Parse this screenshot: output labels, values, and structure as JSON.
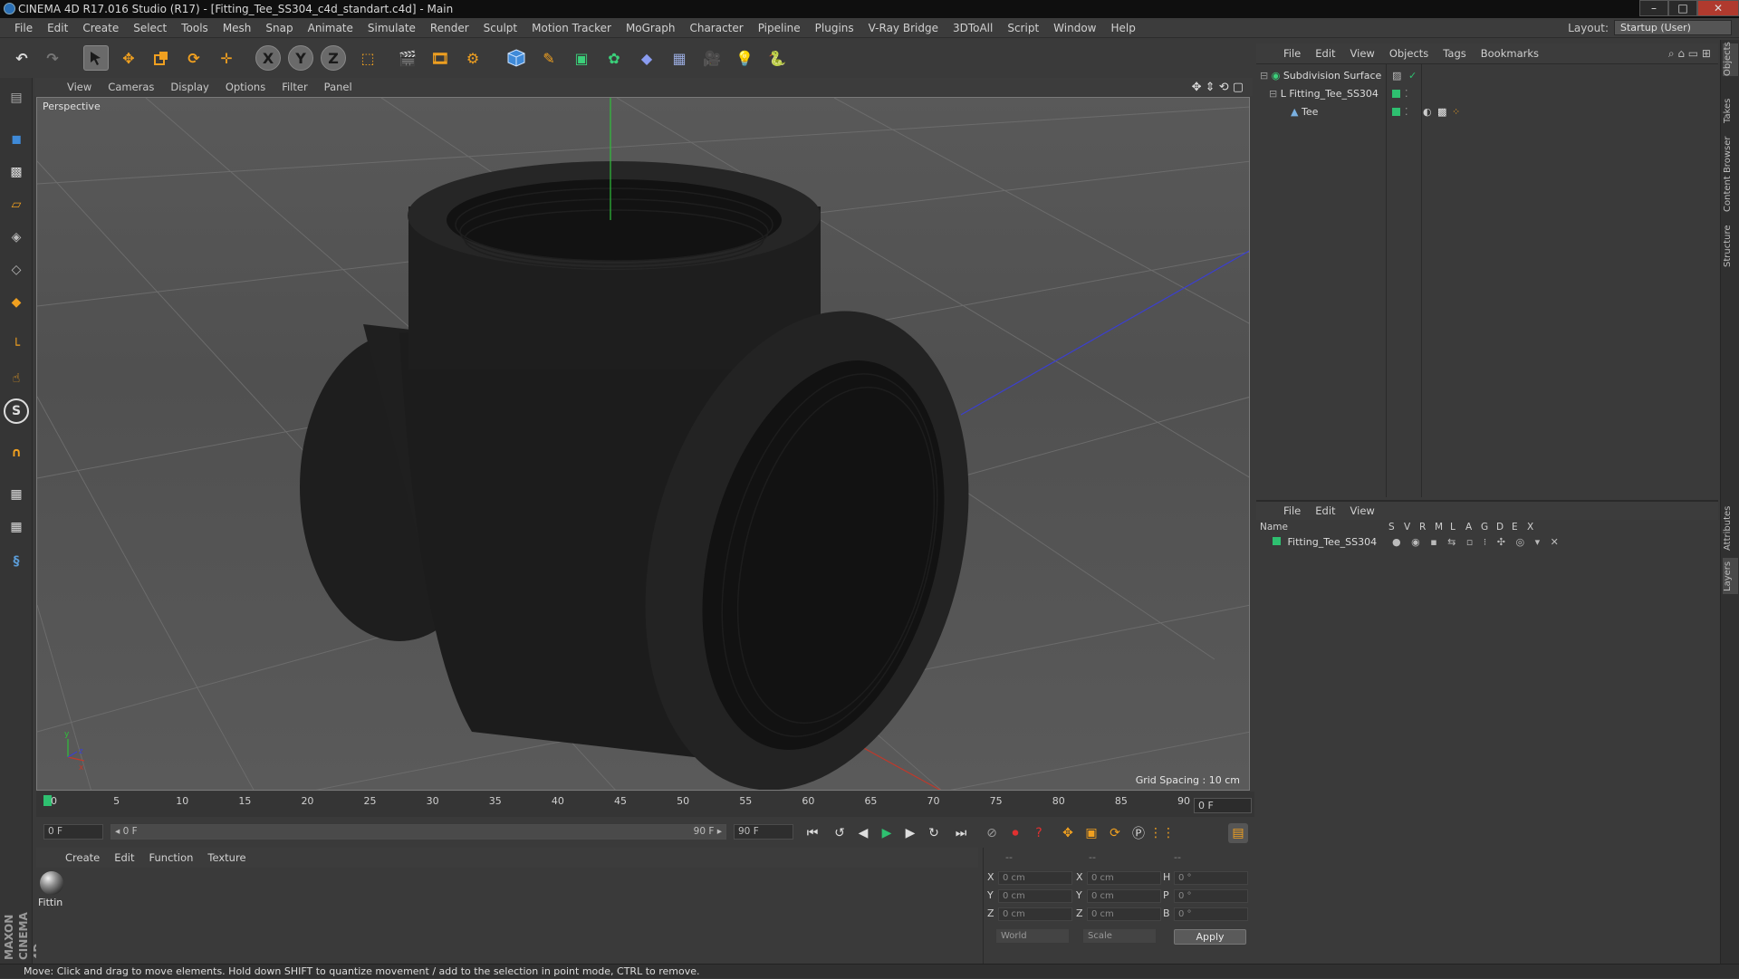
{
  "window": {
    "title": "CINEMA 4D R17.016 Studio (R17) - [Fitting_Tee_SS304_c4d_standart.c4d] - Main",
    "min": "–",
    "max": "□",
    "close": "✕"
  },
  "menu": [
    "File",
    "Edit",
    "Create",
    "Select",
    "Tools",
    "Mesh",
    "Snap",
    "Animate",
    "Simulate",
    "Render",
    "Sculpt",
    "Motion Tracker",
    "MoGraph",
    "Character",
    "Pipeline",
    "Plugins",
    "V-Ray Bridge",
    "3DToAll",
    "Script",
    "Window",
    "Help"
  ],
  "layout": {
    "label": "Layout:",
    "value": "Startup (User)"
  },
  "toolbar": {
    "x_axis": "X",
    "y_axis": "Y",
    "z_axis": "Z"
  },
  "viewport": {
    "menu": [
      "View",
      "Cameras",
      "Display",
      "Options",
      "Filter",
      "Panel"
    ],
    "label": "Perspective",
    "grid_spacing": "Grid Spacing : 10 cm",
    "axis_x": "x",
    "axis_y": "y",
    "axis_z": "z"
  },
  "timeline": {
    "ticks": [
      "0",
      "5",
      "10",
      "15",
      "20",
      "25",
      "30",
      "35",
      "40",
      "45",
      "50",
      "55",
      "60",
      "65",
      "70",
      "75",
      "80",
      "85",
      "90"
    ],
    "current_frame": "0 F",
    "start_field": "0 F",
    "range_start": "◂ 0 F",
    "range_end": "90 F ▸",
    "end_field": "90 F"
  },
  "materials": {
    "menu": [
      "Create",
      "Edit",
      "Function",
      "Texture"
    ],
    "items": [
      {
        "name": "Fittin"
      }
    ]
  },
  "coords": {
    "headers": [
      "--",
      "--",
      "--"
    ],
    "rows": [
      {
        "a": "X",
        "av": "0 cm",
        "b": "X",
        "bv": "0 cm",
        "c": "H",
        "cv": "0 °"
      },
      {
        "a": "Y",
        "av": "0 cm",
        "b": "Y",
        "bv": "0 cm",
        "c": "P",
        "cv": "0 °"
      },
      {
        "a": "Z",
        "av": "0 cm",
        "b": "Z",
        "bv": "0 cm",
        "c": "B",
        "cv": "0 °"
      }
    ],
    "mode_world": "World",
    "mode_scale": "Scale",
    "apply": "Apply"
  },
  "objects": {
    "menu": [
      "File",
      "Edit",
      "View",
      "Objects",
      "Tags",
      "Bookmarks"
    ],
    "tree": [
      {
        "name": "Subdivision Surface",
        "indent": 0
      },
      {
        "name": "Fitting_Tee_SS304",
        "indent": 1
      },
      {
        "name": "Tee",
        "indent": 2
      }
    ]
  },
  "layers": {
    "menu": [
      "File",
      "Edit",
      "View"
    ],
    "columns": [
      "Name",
      "S",
      "V",
      "R",
      "M",
      "L",
      "A",
      "G",
      "D",
      "E",
      "X"
    ],
    "rows": [
      {
        "name": "Fitting_Tee_SS304"
      }
    ]
  },
  "side_tabs": [
    "Objects",
    "Takes",
    "Content Browser",
    "Structure",
    "Attributes",
    "Layers"
  ],
  "branding": "MAXON CINEMA 4D",
  "status": "Move: Click and drag to move elements. Hold down SHIFT to quantize movement / add to the selection in point mode, CTRL to remove.",
  "colors": {
    "accent_orange": "#f0a020",
    "accent_blue": "#3f8ad8",
    "layer_green": "#2ec070",
    "axis_y": "#2fbf3a",
    "axis_x": "#c0392b",
    "axis_z": "#3b3fd0"
  }
}
